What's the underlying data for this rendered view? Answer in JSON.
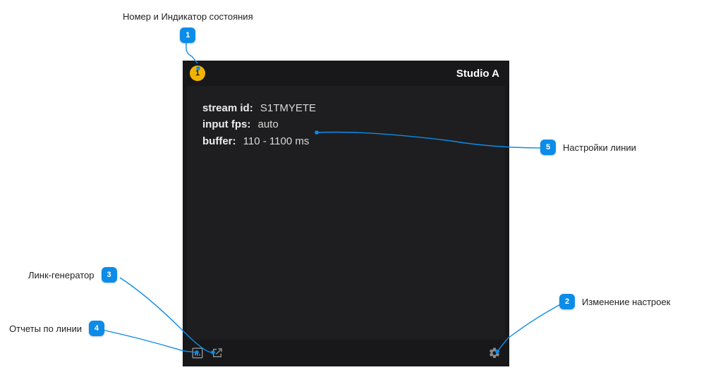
{
  "panel": {
    "status_number": "1",
    "title": "Studio A",
    "fields": {
      "stream_id_label": "stream id:",
      "stream_id_value": "S1TMYETE",
      "input_fps_label": "input fps:",
      "input_fps_value": "auto",
      "buffer_label": "buffer:",
      "buffer_value": "110 - 1100 ms"
    }
  },
  "callouts": {
    "c1": {
      "num": "1",
      "label": "Номер и Индикатор состояния"
    },
    "c2": {
      "num": "2",
      "label": "Изменение настроек"
    },
    "c3": {
      "num": "3",
      "label": "Линк-генератор"
    },
    "c4": {
      "num": "4",
      "label": "Отчеты по линии"
    },
    "c5": {
      "num": "5",
      "label": "Настройки линии"
    }
  }
}
